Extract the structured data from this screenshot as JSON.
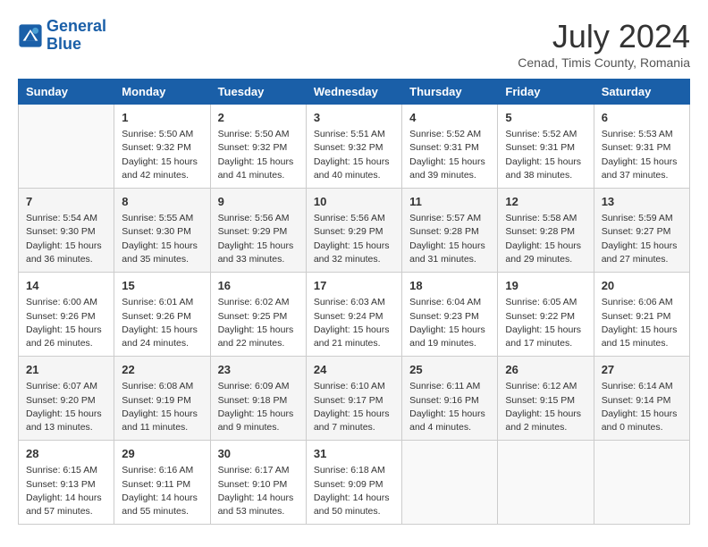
{
  "header": {
    "logo_line1": "General",
    "logo_line2": "Blue",
    "month_year": "July 2024",
    "location": "Cenad, Timis County, Romania"
  },
  "days_of_week": [
    "Sunday",
    "Monday",
    "Tuesday",
    "Wednesday",
    "Thursday",
    "Friday",
    "Saturday"
  ],
  "weeks": [
    [
      {
        "day": "",
        "info": ""
      },
      {
        "day": "1",
        "info": "Sunrise: 5:50 AM\nSunset: 9:32 PM\nDaylight: 15 hours\nand 42 minutes."
      },
      {
        "day": "2",
        "info": "Sunrise: 5:50 AM\nSunset: 9:32 PM\nDaylight: 15 hours\nand 41 minutes."
      },
      {
        "day": "3",
        "info": "Sunrise: 5:51 AM\nSunset: 9:32 PM\nDaylight: 15 hours\nand 40 minutes."
      },
      {
        "day": "4",
        "info": "Sunrise: 5:52 AM\nSunset: 9:31 PM\nDaylight: 15 hours\nand 39 minutes."
      },
      {
        "day": "5",
        "info": "Sunrise: 5:52 AM\nSunset: 9:31 PM\nDaylight: 15 hours\nand 38 minutes."
      },
      {
        "day": "6",
        "info": "Sunrise: 5:53 AM\nSunset: 9:31 PM\nDaylight: 15 hours\nand 37 minutes."
      }
    ],
    [
      {
        "day": "7",
        "info": "Sunrise: 5:54 AM\nSunset: 9:30 PM\nDaylight: 15 hours\nand 36 minutes."
      },
      {
        "day": "8",
        "info": "Sunrise: 5:55 AM\nSunset: 9:30 PM\nDaylight: 15 hours\nand 35 minutes."
      },
      {
        "day": "9",
        "info": "Sunrise: 5:56 AM\nSunset: 9:29 PM\nDaylight: 15 hours\nand 33 minutes."
      },
      {
        "day": "10",
        "info": "Sunrise: 5:56 AM\nSunset: 9:29 PM\nDaylight: 15 hours\nand 32 minutes."
      },
      {
        "day": "11",
        "info": "Sunrise: 5:57 AM\nSunset: 9:28 PM\nDaylight: 15 hours\nand 31 minutes."
      },
      {
        "day": "12",
        "info": "Sunrise: 5:58 AM\nSunset: 9:28 PM\nDaylight: 15 hours\nand 29 minutes."
      },
      {
        "day": "13",
        "info": "Sunrise: 5:59 AM\nSunset: 9:27 PM\nDaylight: 15 hours\nand 27 minutes."
      }
    ],
    [
      {
        "day": "14",
        "info": "Sunrise: 6:00 AM\nSunset: 9:26 PM\nDaylight: 15 hours\nand 26 minutes."
      },
      {
        "day": "15",
        "info": "Sunrise: 6:01 AM\nSunset: 9:26 PM\nDaylight: 15 hours\nand 24 minutes."
      },
      {
        "day": "16",
        "info": "Sunrise: 6:02 AM\nSunset: 9:25 PM\nDaylight: 15 hours\nand 22 minutes."
      },
      {
        "day": "17",
        "info": "Sunrise: 6:03 AM\nSunset: 9:24 PM\nDaylight: 15 hours\nand 21 minutes."
      },
      {
        "day": "18",
        "info": "Sunrise: 6:04 AM\nSunset: 9:23 PM\nDaylight: 15 hours\nand 19 minutes."
      },
      {
        "day": "19",
        "info": "Sunrise: 6:05 AM\nSunset: 9:22 PM\nDaylight: 15 hours\nand 17 minutes."
      },
      {
        "day": "20",
        "info": "Sunrise: 6:06 AM\nSunset: 9:21 PM\nDaylight: 15 hours\nand 15 minutes."
      }
    ],
    [
      {
        "day": "21",
        "info": "Sunrise: 6:07 AM\nSunset: 9:20 PM\nDaylight: 15 hours\nand 13 minutes."
      },
      {
        "day": "22",
        "info": "Sunrise: 6:08 AM\nSunset: 9:19 PM\nDaylight: 15 hours\nand 11 minutes."
      },
      {
        "day": "23",
        "info": "Sunrise: 6:09 AM\nSunset: 9:18 PM\nDaylight: 15 hours\nand 9 minutes."
      },
      {
        "day": "24",
        "info": "Sunrise: 6:10 AM\nSunset: 9:17 PM\nDaylight: 15 hours\nand 7 minutes."
      },
      {
        "day": "25",
        "info": "Sunrise: 6:11 AM\nSunset: 9:16 PM\nDaylight: 15 hours\nand 4 minutes."
      },
      {
        "day": "26",
        "info": "Sunrise: 6:12 AM\nSunset: 9:15 PM\nDaylight: 15 hours\nand 2 minutes."
      },
      {
        "day": "27",
        "info": "Sunrise: 6:14 AM\nSunset: 9:14 PM\nDaylight: 15 hours\nand 0 minutes."
      }
    ],
    [
      {
        "day": "28",
        "info": "Sunrise: 6:15 AM\nSunset: 9:13 PM\nDaylight: 14 hours\nand 57 minutes."
      },
      {
        "day": "29",
        "info": "Sunrise: 6:16 AM\nSunset: 9:11 PM\nDaylight: 14 hours\nand 55 minutes."
      },
      {
        "day": "30",
        "info": "Sunrise: 6:17 AM\nSunset: 9:10 PM\nDaylight: 14 hours\nand 53 minutes."
      },
      {
        "day": "31",
        "info": "Sunrise: 6:18 AM\nSunset: 9:09 PM\nDaylight: 14 hours\nand 50 minutes."
      },
      {
        "day": "",
        "info": ""
      },
      {
        "day": "",
        "info": ""
      },
      {
        "day": "",
        "info": ""
      }
    ]
  ]
}
